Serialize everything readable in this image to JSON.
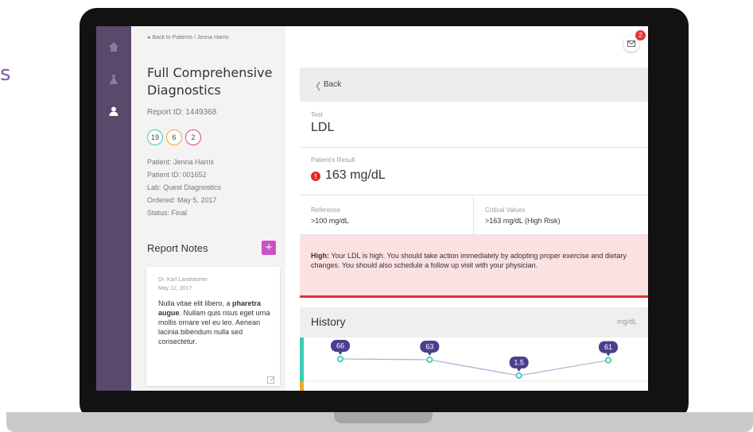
{
  "background_fragment": "s",
  "sidebar": {
    "items": [
      {
        "name": "home",
        "icon": "home-icon",
        "active": false
      },
      {
        "name": "lab",
        "icon": "flask-icon",
        "active": false
      },
      {
        "name": "patients",
        "icon": "user-icon",
        "active": true
      }
    ]
  },
  "breadcrumb": "Back to Patients / Jenna Harris",
  "report": {
    "title": "Full Comprehensive Diagnostics",
    "id": "Report ID: 1449368",
    "badges": [
      {
        "value": "19",
        "color": "#3ecbb6"
      },
      {
        "value": "6",
        "color": "#f5a623"
      },
      {
        "value": "2",
        "color": "#e0467c"
      }
    ],
    "meta": [
      "Patient: Jenna Harris",
      "Patient ID: 001652",
      "Lab: Quest Diagnostics",
      "Ordered: May 5, 2017",
      "Status: Final"
    ]
  },
  "notes": {
    "title": "Report Notes",
    "add_label": "+",
    "items": [
      {
        "author": "Dr. Karl Landsteiner",
        "date": "May 12, 2017",
        "body_before": "Nulla vitae elit libero, a ",
        "body_bold": "pharetra augue",
        "body_after": ". Nullam quis risus eget urna mollis ornare vel eu leo. Aenean lacinia bibendum nulla sed consectetur."
      }
    ]
  },
  "header": {
    "mail_count": "2"
  },
  "detail": {
    "back_label": "Back",
    "test_label": "Test",
    "test_value": "LDL",
    "result_label": "Patient's Result",
    "result_value": "163 mg/dL",
    "result_icon": "!",
    "reference_label": "Reference",
    "reference_value": ">100 mg/dL",
    "critical_label": "Critical Values",
    "critical_value": ">163 mg/dL (High Risk)",
    "alert_bold": "High:",
    "alert_text": " Your LDL is high. You should take action immediately by adopting proper exercise and dietary changes. You should also schedule a follow up visit with your physician."
  },
  "history": {
    "title": "History",
    "unit": "mg/dL"
  },
  "chart_data": {
    "type": "line",
    "values": [
      66,
      63,
      1.5,
      61
    ],
    "labels": [
      "66",
      "63",
      "1.5",
      "61"
    ],
    "line_color": "#b9afd8",
    "point_color": "#3ecbb6",
    "bubble_color": "#4b3f8f"
  },
  "colors": {
    "sidebar": "#59496b",
    "accent": "#7b5ea7",
    "add": "#c951c6",
    "alert_bg": "#fbe1e1",
    "alert_border": "#e0332f"
  }
}
